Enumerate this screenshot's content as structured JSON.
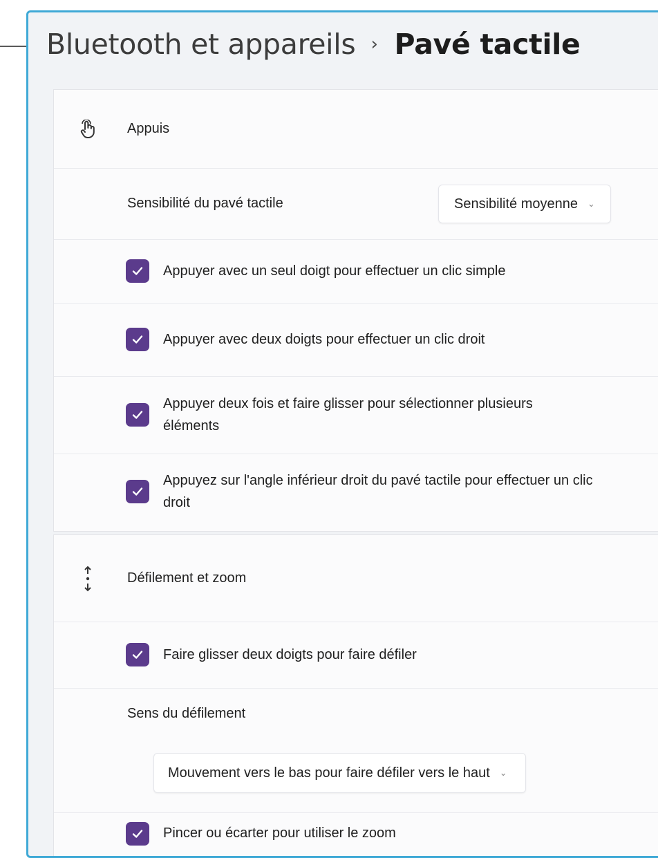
{
  "breadcrumb": {
    "parent": "Bluetooth et appareils",
    "separator": "›",
    "current": "Pavé tactile"
  },
  "appuis": {
    "title": "Appuis",
    "icon": "tap-hand-icon",
    "sensitivity_label": "Sensibilité du pavé tactile",
    "sensitivity_value": "Sensibilité moyenne",
    "options": [
      {
        "label": "Appuyer avec un seul doigt pour effectuer un clic simple",
        "checked": true
      },
      {
        "label": "Appuyer avec deux doigts pour effectuer un clic droit",
        "checked": true
      },
      {
        "label": "Appuyer deux fois et faire glisser pour sélectionner plusieurs éléments",
        "checked": true
      },
      {
        "label": "Appuyez sur l'angle inférieur droit du pavé tactile pour effectuer un clic droit",
        "checked": true
      }
    ]
  },
  "scroll_zoom": {
    "title": "Défilement et zoom",
    "icon": "scroll-arrows-icon",
    "two_finger_scroll": {
      "label": "Faire glisser deux doigts pour faire défiler",
      "checked": true
    },
    "direction_label": "Sens du défilement",
    "direction_value": "Mouvement vers le bas pour faire défiler vers le haut",
    "pinch_zoom": {
      "label": "Pincer ou écarter pour utiliser le zoom",
      "checked": true
    }
  },
  "colors": {
    "accent": "#5b3b8c",
    "window_border": "#3fa9d6",
    "background": "#f1f3f6"
  }
}
